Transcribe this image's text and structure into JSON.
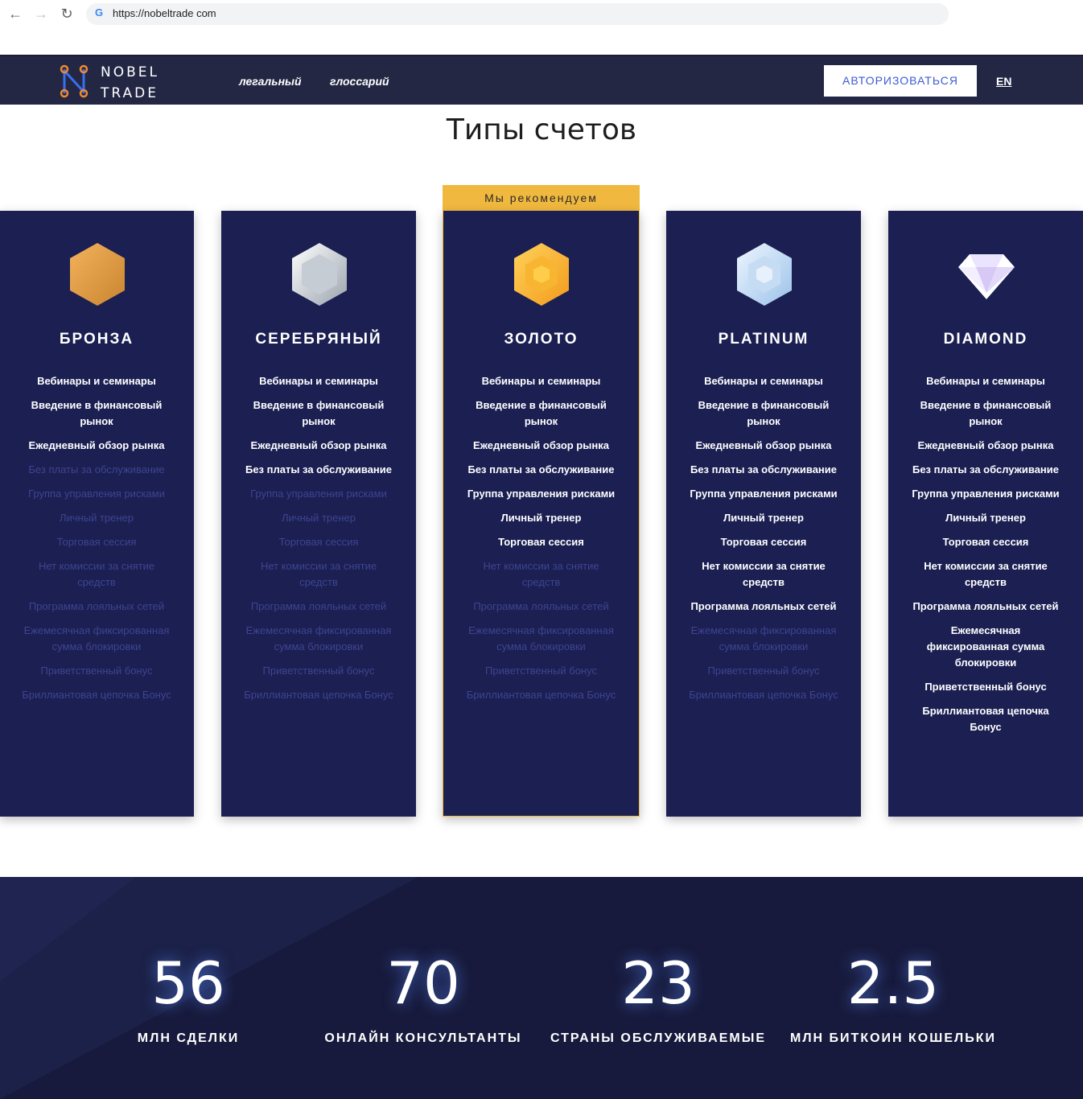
{
  "browser": {
    "url": "https://nobeltrade com",
    "back_icon": "←",
    "forward_icon": "→",
    "reload_icon": "↻",
    "g_icon": "G"
  },
  "header": {
    "logo_line1": "NOBEL",
    "logo_line2": "TRADE",
    "nav": [
      "легальный",
      "глоссарий"
    ],
    "auth_button": "АВТОРИЗОВАТЬСЯ",
    "lang": "EN"
  },
  "page_title": "Типы счетов",
  "recommended_label": "Мы рекомендуем",
  "features": [
    "Вебинары и семинары",
    "Введение в финансовый рынок",
    "Ежедневный обзор рынка",
    "Без платы за обслуживание",
    "Группа управления рисками",
    "Личный тренер",
    "Торговая сессия",
    "Нет комиссии за снятие средств",
    "Программа лояльных сетей",
    "Ежемесячная фиксированная сумма блокировки",
    "Приветственный бонус",
    "Бриллиантовая цепочка Бонус"
  ],
  "plans": [
    {
      "name": "БРОНЗА",
      "icon": "bronze-hexagon-icon",
      "enabled": [
        1,
        1,
        1,
        0,
        0,
        0,
        0,
        0,
        0,
        0,
        0,
        0
      ]
    },
    {
      "name": "СЕРЕБРЯНЫЙ",
      "icon": "silver-hexagon-icon",
      "enabled": [
        1,
        1,
        1,
        1,
        0,
        0,
        0,
        0,
        0,
        0,
        0,
        0
      ]
    },
    {
      "name": "ЗОЛОТО",
      "icon": "gold-hexagon-icon",
      "enabled": [
        1,
        1,
        1,
        1,
        1,
        1,
        1,
        0,
        0,
        0,
        0,
        0
      ]
    },
    {
      "name": "PLATINUM",
      "icon": "platinum-hexagon-icon",
      "enabled": [
        1,
        1,
        1,
        1,
        1,
        1,
        1,
        1,
        1,
        0,
        0,
        0
      ]
    },
    {
      "name": "DIAMOND",
      "icon": "diamond-icon",
      "enabled": [
        1,
        1,
        1,
        1,
        1,
        1,
        1,
        1,
        1,
        1,
        1,
        1
      ]
    }
  ],
  "colors": {
    "card_bg": "#1b1f52",
    "accent_gold": "#f0b83f",
    "header_bg": "#232744",
    "feature_off": "#3d4590"
  },
  "stats": [
    {
      "value": "56",
      "label": "МЛН СДЕЛКИ"
    },
    {
      "value": "70",
      "label": "ОНЛАЙН КОНСУЛЬТАНТЫ"
    },
    {
      "value": "23",
      "label": "СТРАНЫ ОБСЛУЖИВАЕМЫЕ"
    },
    {
      "value": "2.5",
      "label": "МЛН БИТКОИН КОШЕЛЬКИ"
    }
  ]
}
